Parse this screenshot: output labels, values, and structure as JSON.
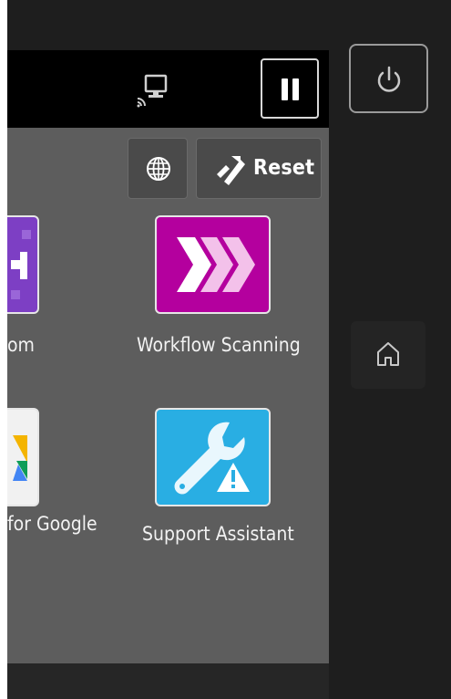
{
  "header": {
    "remote_icon": "remote-display-icon",
    "pause_icon": "pause-icon"
  },
  "toolbar": {
    "language_icon": "globe-icon",
    "reset_icon": "reset-icon",
    "reset_label": "Reset"
  },
  "apps": [
    {
      "label": "om",
      "icon": "app-purple-icon",
      "color": "#7d3fc4"
    },
    {
      "label": "Workflow Scanning",
      "icon": "workflow-scanning-icon",
      "color": "#b4009e"
    },
    {
      "label": "for Google",
      "icon": "google-drive-icon",
      "color": "#f1f1f1"
    },
    {
      "label": "Support Assistant",
      "icon": "support-assistant-icon",
      "color": "#29aee3"
    }
  ],
  "hardware": {
    "power_icon": "power-icon",
    "home_icon": "home-icon"
  }
}
